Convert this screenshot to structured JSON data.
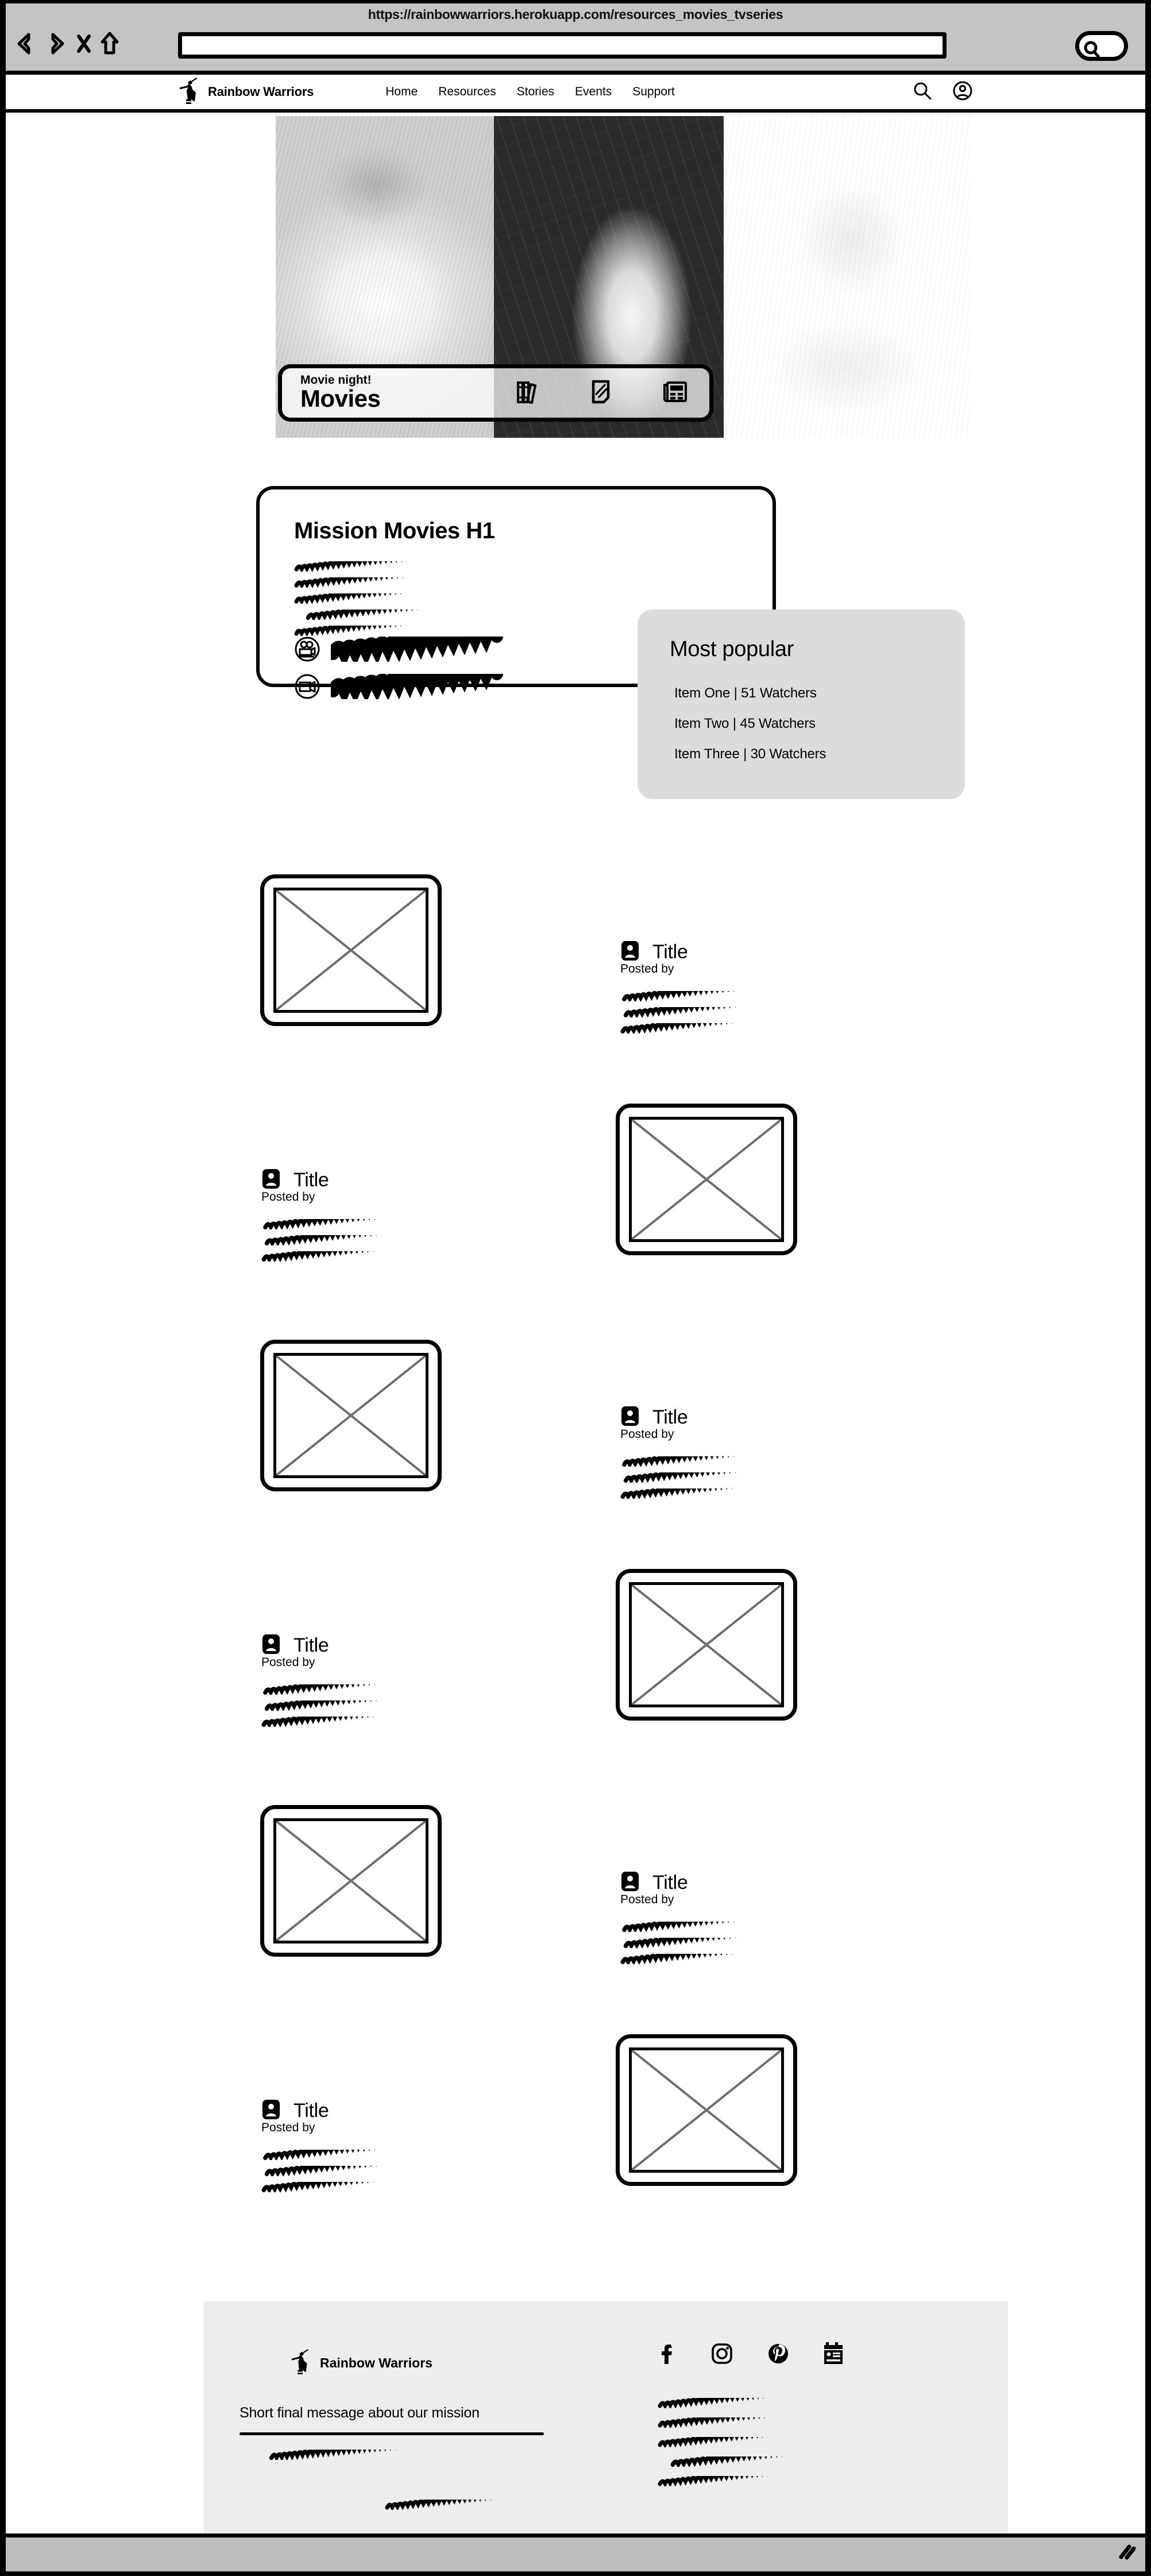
{
  "browser": {
    "url": "https://rainbowwarriors.herokuapp.com/resources_movies_tvseries",
    "back_icon": "back-arrow-icon",
    "forward_icon": "forward-arrow-icon",
    "stop_icon": "close-x-icon",
    "home_icon": "home-icon",
    "address_value": "",
    "search_icon": "search-icon"
  },
  "nav": {
    "brand": "Rainbow Warriors",
    "logo_icon": "warrior-logo-icon",
    "links": [
      "Home",
      "Resources",
      "Stories",
      "Events",
      "Support"
    ],
    "search_icon": "search-icon",
    "account_icon": "account-circle-icon"
  },
  "hero": {
    "kicker": "Movie night!",
    "title": "Movies",
    "icons": [
      "books-icon",
      "note-document-icon",
      "newspaper-icon"
    ],
    "images": [
      "photo-person-smiling",
      "photo-videographer",
      "photo-person-flag"
    ]
  },
  "mission": {
    "heading": "Mission Movies H1",
    "body_lines": 5,
    "rows": [
      {
        "icon": "film-projector-icon"
      },
      {
        "icon": "video-camera-icon"
      }
    ]
  },
  "popular": {
    "title": "Most popular",
    "items": [
      "Item One | 51 Watchers",
      "Item Two | 45 Watchers",
      "Item Three | 30 Watchers"
    ]
  },
  "articles": [
    {
      "title": "Title",
      "posted_by": "Posted by",
      "image_side": "left",
      "avatar_icon": "avatar-badge-icon"
    },
    {
      "title": "Title",
      "posted_by": "Posted by",
      "image_side": "right",
      "avatar_icon": "avatar-badge-icon"
    },
    {
      "title": "Title",
      "posted_by": "Posted by",
      "image_side": "left",
      "avatar_icon": "avatar-badge-icon"
    },
    {
      "title": "Title",
      "posted_by": "Posted by",
      "image_side": "right",
      "avatar_icon": "avatar-badge-icon"
    },
    {
      "title": "Title",
      "posted_by": "Posted by",
      "image_side": "left",
      "avatar_icon": "avatar-badge-icon"
    },
    {
      "title": "Title",
      "posted_by": "Posted by",
      "image_side": "right",
      "avatar_icon": "avatar-badge-icon"
    }
  ],
  "footer": {
    "brand": "Rainbow Warriors",
    "logo_icon": "warrior-logo-icon",
    "message": "Short final message about our mission",
    "social": [
      "facebook-icon",
      "instagram-icon",
      "pinterest-icon",
      "newspaper-icon"
    ]
  },
  "colors": {
    "chrome_gray": "#c4c4c4",
    "status_gray": "#bdbdbd",
    "footer_gray": "#ededed",
    "popular_gray": "#dcdcdc",
    "ink": "#000000",
    "placeholder_x": "#6e6e6e"
  }
}
